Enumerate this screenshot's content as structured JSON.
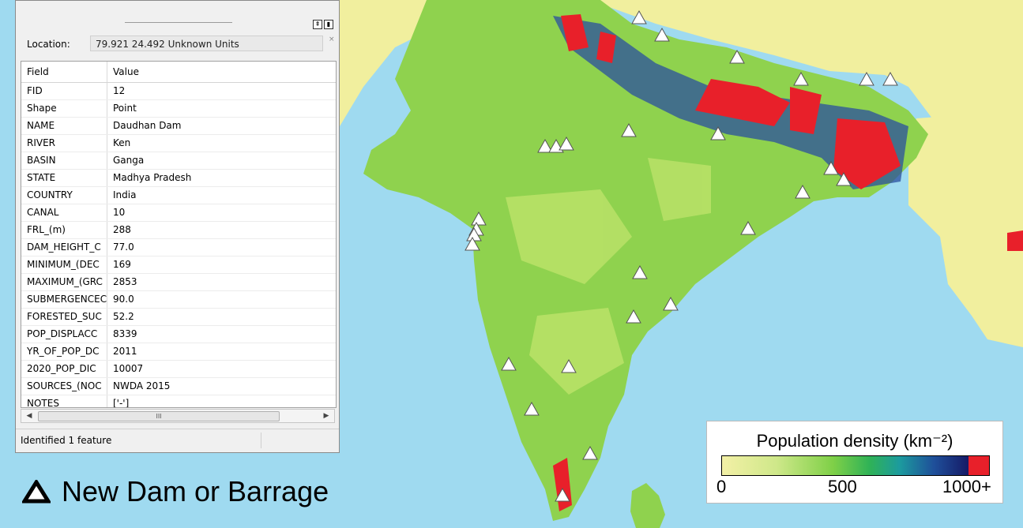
{
  "window": {
    "location_label": "Location:",
    "location_value": "79.921  24.492 Unknown Units",
    "columns": {
      "field": "Field",
      "value": "Value"
    },
    "rows": [
      {
        "field": "FID",
        "value": "12"
      },
      {
        "field": "Shape",
        "value": "Point"
      },
      {
        "field": "NAME",
        "value": "Daudhan Dam"
      },
      {
        "field": "RIVER",
        "value": "Ken"
      },
      {
        "field": "BASIN",
        "value": "Ganga"
      },
      {
        "field": "STATE",
        "value": "Madhya Pradesh"
      },
      {
        "field": "COUNTRY",
        "value": "India"
      },
      {
        "field": "CANAL",
        "value": "10"
      },
      {
        "field": "FRL_(m)",
        "value": "288"
      },
      {
        "field": "DAM_HEIGHT_C",
        "value": "77.0"
      },
      {
        "field": "MINIMUM_(DEC",
        "value": "169"
      },
      {
        "field": "MAXIMUM_(GRC",
        "value": "2853"
      },
      {
        "field": "SUBMERGENCEC",
        "value": "90.0"
      },
      {
        "field": "FORESTED_SUC",
        "value": "52.2"
      },
      {
        "field": "POP_DISPLACC",
        "value": "8339"
      },
      {
        "field": "YR_OF_POP_DC",
        "value": "2011"
      },
      {
        "field": "2020_POP_DIC",
        "value": "10007"
      },
      {
        "field": "SOURCES_(NOC",
        "value": "NWDA 2015"
      },
      {
        "field": "NOTES",
        "value": "['-']"
      }
    ],
    "status_text": "Identified 1 feature",
    "scroll_thumb_glyph": "III",
    "scroll_left_glyph": "◀",
    "scroll_right_glyph": "▶"
  },
  "dam_legend": {
    "label": "New Dam or Barrage",
    "icon": "triangle-outline-icon"
  },
  "pop_legend": {
    "title": "Population density (km⁻²)",
    "ticks": [
      "0",
      "500",
      "1000+"
    ],
    "colors": {
      "low": "#f3f0a6",
      "mid": "#2fb257",
      "high": "#151a66",
      "max": "#e8202a"
    }
  },
  "colors": {
    "sea": "#9fdaf0",
    "land_neighbor": "#f1ef9e",
    "land_india": "#8fd24e",
    "dense": "#e8202a",
    "blue": "#2a4f9f"
  }
}
